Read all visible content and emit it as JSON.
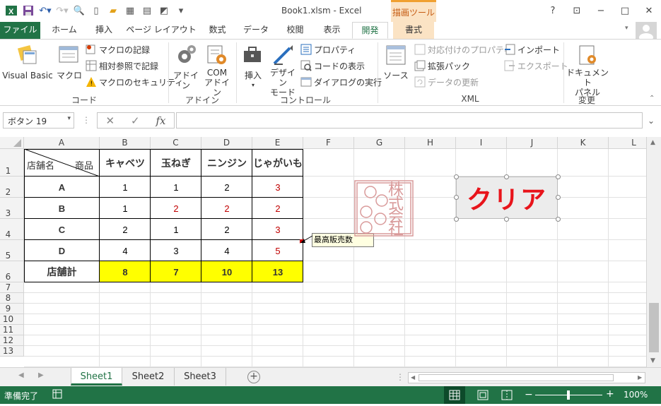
{
  "title": "Book1.xlsm - Excel",
  "context_tab_header": "描画ツール",
  "window_controls": [
    "?",
    "restore",
    "−",
    "□",
    "×"
  ],
  "tabs": [
    "ファイル",
    "ホーム",
    "挿入",
    "ページ レイアウト",
    "数式",
    "データ",
    "校閲",
    "表示",
    "開発",
    "書式"
  ],
  "active_tab": "開発",
  "ribbon": {
    "groups": {
      "code": "コード",
      "addins": "アドイン",
      "controls": "コントロール",
      "xml": "XML",
      "modify": "変更"
    },
    "visual_basic": "Visual Basic",
    "macro": "マクロ",
    "record_macro": "マクロの記録",
    "relative_ref": "相対参照で記録",
    "macro_security": "マクロのセキュリティ",
    "addins": "アドイン",
    "com_addins_1": "COM",
    "com_addins_2": "アドイン",
    "insert": "挿入",
    "design_mode_1": "デザイン",
    "design_mode_2": "モード",
    "properties": "プロパティ",
    "view_code": "コードの表示",
    "run_dialog": "ダイアログの実行",
    "source": "ソース",
    "map_properties": "対応付けのプロパティ",
    "expansion_packs": "拡張パック",
    "refresh_data": "データの更新",
    "import": "インポート",
    "export": "エクスポート",
    "doc_panel_1": "ドキュメント",
    "doc_panel_2": "パネル"
  },
  "formula_bar": {
    "name_box": "ボタン 19",
    "fx": "fx",
    "value": ""
  },
  "columns": [
    "A",
    "B",
    "C",
    "D",
    "E",
    "F",
    "G",
    "H",
    "I",
    "J",
    "K",
    "L"
  ],
  "rows": [
    "1",
    "2",
    "3",
    "4",
    "5",
    "6",
    "7",
    "8",
    "9",
    "10",
    "11",
    "12",
    "13"
  ],
  "table": {
    "header_diag_left": "店舗名",
    "header_diag_right": "商品",
    "products": [
      "キャベツ",
      "玉ねぎ",
      "ニンジン",
      "じゃがいも"
    ],
    "stores": [
      {
        "name": "A",
        "values": [
          "1",
          "1",
          "2",
          "3"
        ],
        "red": [
          false,
          false,
          false,
          true
        ]
      },
      {
        "name": "B",
        "values": [
          "1",
          "2",
          "2",
          "2"
        ],
        "red": [
          false,
          true,
          true,
          true
        ]
      },
      {
        "name": "C",
        "values": [
          "2",
          "1",
          "2",
          "3"
        ],
        "red": [
          false,
          false,
          false,
          true
        ]
      },
      {
        "name": "D",
        "values": [
          "4",
          "3",
          "4",
          "5"
        ],
        "red": [
          false,
          false,
          false,
          true
        ]
      }
    ],
    "total_label": "店舗計",
    "totals": [
      "8",
      "7",
      "10",
      "13"
    ]
  },
  "comment": "最高販売数",
  "stamp_text": "株式会社",
  "clear_button": "クリア",
  "sheets": [
    "Sheet1",
    "Sheet2",
    "Sheet3"
  ],
  "active_sheet": "Sheet1",
  "status": {
    "ready": "準備完了",
    "zoom": "100%"
  },
  "colors": {
    "excel_green": "#217346",
    "highlight": "#ffff00",
    "red": "#e8141b"
  }
}
